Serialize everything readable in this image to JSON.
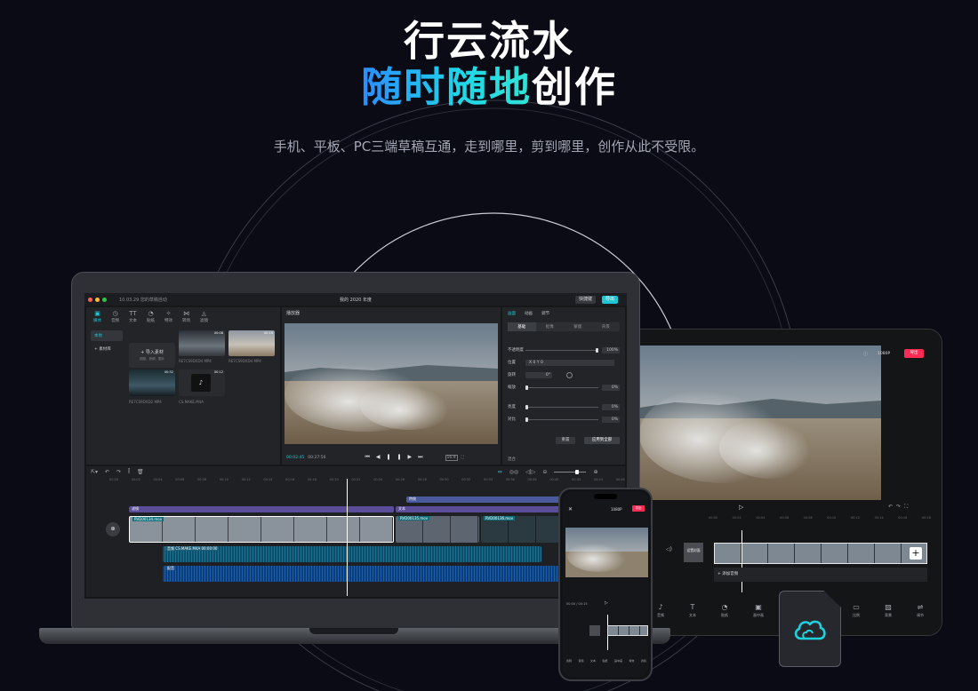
{
  "hero": {
    "line1": "行云流水",
    "line2_highlight": "随时随地",
    "line2_rest": "创作",
    "subtitle": "手机、平板、PC三端草稿互通，走到哪里，剪到哪里，创作从此不受限。"
  },
  "laptop": {
    "window_title": "我的 2020 年度",
    "draft_label": "10.03.29 您的草稿自动",
    "shortcut_button": "快捷键",
    "export_button": "导出",
    "media_tabs": [
      {
        "label": "媒体",
        "icon": "▣"
      },
      {
        "label": "音频",
        "icon": "◷"
      },
      {
        "label": "文本",
        "icon": "TT"
      },
      {
        "label": "贴纸",
        "icon": "◔"
      },
      {
        "label": "特效",
        "icon": "✧"
      },
      {
        "label": "转场",
        "icon": "⋈"
      },
      {
        "label": "滤镜",
        "icon": "◬"
      }
    ],
    "media_side": [
      "本地",
      "+ 素材库"
    ],
    "import_label": "+ 导入素材",
    "import_hint": "视频、音频、图片",
    "thumb_durations": [
      "00:08",
      "00:16",
      "00:32",
      "00:12"
    ],
    "thumb_names": [
      "RE7CS9DXD4 MP4",
      "RE7CS9DXD4 MP4",
      "RE7CS9DXD2 MP4",
      "CS.MAKE.M4A"
    ],
    "player_title": "播放器",
    "time_current": "00:02:45",
    "time_total": "00:27:56",
    "aspect": "16:9",
    "props_tabs": [
      "画面",
      "动画",
      "调节"
    ],
    "props_sub": [
      "基础",
      "抠像",
      "蒙版",
      "背景"
    ],
    "props_rows": [
      {
        "label": "不透明度",
        "value": "100%"
      },
      {
        "label": "位置",
        "value": "X 0  Y 0"
      },
      {
        "label": "旋转",
        "value": "0°"
      },
      {
        "label": "缩放",
        "value": "0%"
      },
      {
        "label": "亮度",
        "value": "0%"
      },
      {
        "label": "对比",
        "value": "0%"
      }
    ],
    "props_buttons": [
      "重置",
      "应用到全部"
    ],
    "props_footer": "混合",
    "timeline_ticks": [
      "00:00",
      "00:02",
      "00:04",
      "00:06",
      "00:08",
      "00:10",
      "00:12",
      "00:14",
      "00:16",
      "00:18",
      "00:20",
      "00:22",
      "00:24",
      "00:26",
      "00:28",
      "00:30",
      "00:32",
      "00:34",
      "00:36",
      "00:38",
      "00:40",
      "00:42",
      "00:44",
      "00:46"
    ],
    "track_labels": {
      "filter": "滤镜",
      "effect": "特效",
      "text": "文本",
      "video1": "RVD00134.mov",
      "video2": "RVD00135.mov",
      "video3": "RVD00136.mov",
      "audio1": "音频 CS.MAKE.M4A 00:00:00",
      "audio2": "配音"
    }
  },
  "tablet": {
    "resolution": "1080P",
    "export_button": "导出",
    "add_audio": "+ 添加音频",
    "cover_label": "设置封面",
    "tools": [
      {
        "label": "音频",
        "icon": "♪"
      },
      {
        "label": "文本",
        "icon": "T"
      },
      {
        "label": "贴纸",
        "icon": "◔"
      },
      {
        "label": "画中画",
        "icon": "▣"
      },
      {
        "label": "特效",
        "icon": "✧"
      },
      {
        "label": "滤镜",
        "icon": "◬"
      },
      {
        "label": "比例",
        "icon": "▭"
      },
      {
        "label": "背景",
        "icon": "▨"
      },
      {
        "label": "调节",
        "icon": "⇌"
      }
    ],
    "ticks": [
      "00:00",
      "00:02",
      "00:04",
      "00:06",
      "00:08",
      "00:10",
      "00:12",
      "00:14",
      "00:16",
      "00:18"
    ]
  },
  "phone": {
    "resolution": "1080P",
    "export_button": "导出",
    "time": "00:00 / 00:15",
    "tools": [
      "剪辑",
      "音频",
      "文本",
      "贴纸",
      "画中画",
      "特效",
      "滤镜"
    ]
  },
  "colors": {
    "bg": "#0a0b14",
    "accent_cyan": "#1fc6d4",
    "accent_blue": "#2a8cff",
    "export_red": "#fe2c55"
  }
}
